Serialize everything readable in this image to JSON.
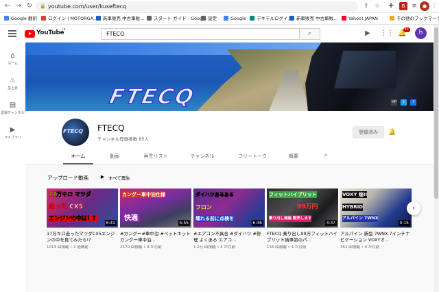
{
  "browser": {
    "url": "youtube.com/user/kuseftecq",
    "bookmarks": [
      {
        "label": "Google 翻訳",
        "color": "#4285f4"
      },
      {
        "label": "ログイン | MOTORGA...",
        "color": "#e53935"
      },
      {
        "label": "新車販売 中古車販...",
        "color": "#1565c0"
      },
      {
        "label": "スタート ガイド - Goog...",
        "color": "#5f6368"
      },
      {
        "label": "設定",
        "color": "#5f6368"
      },
      {
        "label": "Google",
        "color": "#4285f4"
      },
      {
        "label": "デキテルログイン",
        "color": "#00897b"
      },
      {
        "label": "新車販売 中古車販...",
        "color": "#1565c0"
      },
      {
        "label": "Yahoo! JAPAN",
        "color": "#ff0033"
      },
      {
        "label": "その他のブックマーク",
        "color": "#f9a825"
      }
    ]
  },
  "youtube": {
    "logo_text": "YouTube",
    "logo_region": "JP",
    "search_value": "FTECQ",
    "notification_count": "9+",
    "user_initial": "h"
  },
  "guide": [
    {
      "label": "ホーム",
      "icon": "home-icon"
    },
    {
      "label": "急上昇",
      "icon": "trending-icon"
    },
    {
      "label": "登録チャンネル",
      "icon": "subscriptions-icon"
    },
    {
      "label": "ライブラリ",
      "icon": "library-icon"
    }
  ],
  "banner": {
    "text": "FTECQ",
    "links": [
      "HP",
      "t",
      "f"
    ]
  },
  "channel": {
    "avatar_text": "FTECQ",
    "name": "FTECQ",
    "subscribers": "チャンネル登録者数 85人",
    "subscribe_label": "登録済み"
  },
  "tabs": [
    {
      "label": "ホーム",
      "active": true
    },
    {
      "label": "動画",
      "active": false
    },
    {
      "label": "再生リスト",
      "active": false
    },
    {
      "label": "チャンネル",
      "active": false
    },
    {
      "label": "フリートーク",
      "active": false
    },
    {
      "label": "概要",
      "active": false
    }
  ],
  "uploads": {
    "section_title": "アップロード動画",
    "play_all": "すべて再生",
    "videos": [
      {
        "thumb_lines": [
          "17万キロ マツダ",
          "走った CX5",
          "エンジンの中は！？"
        ],
        "duration": "6:41",
        "title": "17万キロ走ったマツダCX5エンジンの中を見てみたら!?",
        "views": "1013 回視聴",
        "age": "2 週間前"
      },
      {
        "thumb_lines": [
          "カングー車中泊仕様",
          "",
          "快適"
        ],
        "duration": "5:55",
        "title": "#カングー#車中泊 #ペットキット カングー車中泊...",
        "views": "2570 回視聴",
        "age": "4 か月前"
      },
      {
        "thumb_lines": [
          "ダイハツあるある",
          "フロン",
          "壊れる前に点検を"
        ],
        "duration": "6:36",
        "title": "#エアコン不具合 #ダイハツ #修理 よくある エアコ...",
        "views": "1.2万 回視聴",
        "age": "4 か月前"
      },
      {
        "thumb_lines": [
          "フィットハイブリット",
          "99万円",
          "乗り出し価格 販売します"
        ],
        "duration": "3:37",
        "title": "FTECQ 乗り出し99万フィットハイブリット納車前のパ...",
        "views": "116 回視聴",
        "age": "4 か月前"
      },
      {
        "thumb_lines": [
          "VOXY 煌II",
          "HYBRID",
          "アルパイン 7WNX"
        ],
        "duration": "0:15",
        "title": "アルパイン 新型 7WNX 7インチナビゲーション VOXYオ...",
        "views": "351 回視聴",
        "age": "4 か月前"
      }
    ]
  }
}
